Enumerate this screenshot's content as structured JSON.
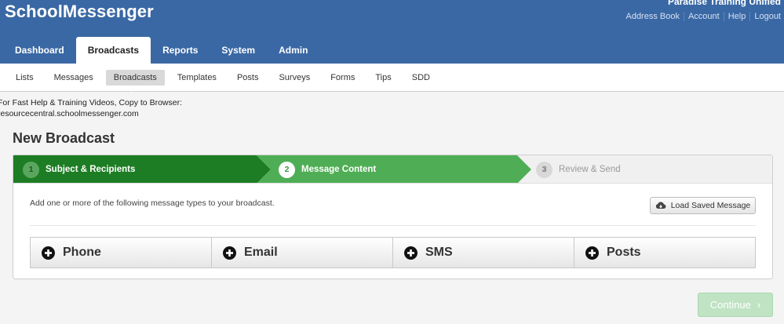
{
  "app": {
    "logo": "SchoolMessenger",
    "org_name": "Paradise Training Unified"
  },
  "util_links": [
    "Address Book",
    "Account",
    "Help",
    "Logout"
  ],
  "main_tabs": [
    {
      "label": "Dashboard",
      "active": false
    },
    {
      "label": "Broadcasts",
      "active": true
    },
    {
      "label": "Reports",
      "active": false
    },
    {
      "label": "System",
      "active": false
    },
    {
      "label": "Admin",
      "active": false
    }
  ],
  "sub_nav": [
    {
      "label": "Lists",
      "active": false
    },
    {
      "label": "Messages",
      "active": false
    },
    {
      "label": "Broadcasts",
      "active": true
    },
    {
      "label": "Templates",
      "active": false
    },
    {
      "label": "Posts",
      "active": false
    },
    {
      "label": "Surveys",
      "active": false
    },
    {
      "label": "Forms",
      "active": false
    },
    {
      "label": "Tips",
      "active": false
    },
    {
      "label": "SDD",
      "active": false
    }
  ],
  "help": {
    "line1": "For Fast Help & Training Videos, Copy to Browser:",
    "line2": "resourcecentral.schoolmessenger.com"
  },
  "page_title": "New Broadcast",
  "steps": [
    {
      "num": "1",
      "label": "Subject & Recipients",
      "state": "complete"
    },
    {
      "num": "2",
      "label": "Message Content",
      "state": "current"
    },
    {
      "num": "3",
      "label": "Review & Send",
      "state": "upcoming"
    }
  ],
  "instruction": "Add one or more of the following message types to your broadcast.",
  "load_saved_label": "Load Saved Message",
  "message_types": [
    {
      "label": "Phone",
      "icon": "plus-circle-icon"
    },
    {
      "label": "Email",
      "icon": "plus-circle-icon"
    },
    {
      "label": "SMS",
      "icon": "plus-circle-icon"
    },
    {
      "label": "Posts",
      "icon": "plus-circle-icon"
    }
  ],
  "continue_label": "Continue",
  "colors": {
    "header_blue": "#3a68a4",
    "step_complete": "#1d7d24",
    "step_current": "#4fae55",
    "continue_disabled": "#bfe3c3"
  }
}
